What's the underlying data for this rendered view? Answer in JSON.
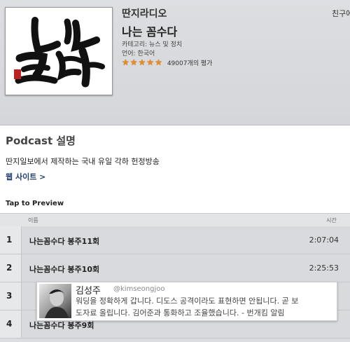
{
  "header": {
    "author": "딴지라디오",
    "title": "나는 꼼수다",
    "category": "카테고리: 뉴스 및 정치",
    "language": "언어: 한국어",
    "rating": {
      "stars": 5,
      "count_label": "49007개의 평가"
    },
    "friends_label": "친구에",
    "artwork": {
      "calligraphy_text": "나는 꼼수다",
      "seal_text": "印"
    }
  },
  "description": {
    "heading": "Podcast 설명",
    "text": "딴지일보에서 제작하는 국내 유일 각하 헌정방송",
    "website_label": "웹 사이트 >"
  },
  "preview": {
    "label": "Tap to Preview",
    "columns": {
      "name": "이름",
      "time": "시간"
    },
    "tracks": [
      {
        "num": "1",
        "name": "나는꼼수다 봉주11회",
        "time": "2:07:04"
      },
      {
        "num": "2",
        "name": "나는꼼수다 봉주10회",
        "time": "2:25:53"
      },
      {
        "num": "3",
        "name": "",
        "time": ""
      },
      {
        "num": "4",
        "name": "나는꼼수다 봉주9회",
        "time": ""
      }
    ]
  },
  "tweet": {
    "name": "김성주",
    "handle": "@kimseongjoo",
    "line1": "워딩을 정확하게 갑니다. 디도스 공격이라도 표현하면 안됩니다. 곧 보",
    "line2": "도자료 올립니다. 김어준과 통화하고 조율했습니다. - 번개킴 알림"
  },
  "colors": {
    "star": "#ef8a1d",
    "link": "#223e73",
    "header_bg": "#d8dadd"
  }
}
